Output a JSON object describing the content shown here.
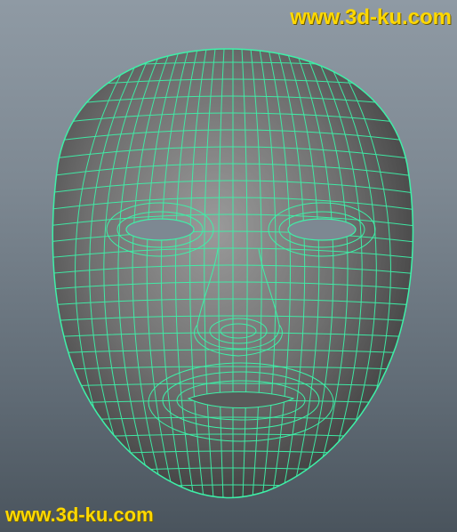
{
  "watermark_top": "www.3d-ku.com",
  "watermark_bottom": "www.3d-ku.com",
  "colors": {
    "background_top": "#8f9aa4",
    "background_bottom": "#4a545d",
    "wireframe": "#3ef0a8",
    "mesh_shading_light": "#9a9a9a",
    "mesh_shading_dark": "#3a3a3a",
    "watermark": "#ffd800"
  },
  "subject": "face-mask-wireframe"
}
